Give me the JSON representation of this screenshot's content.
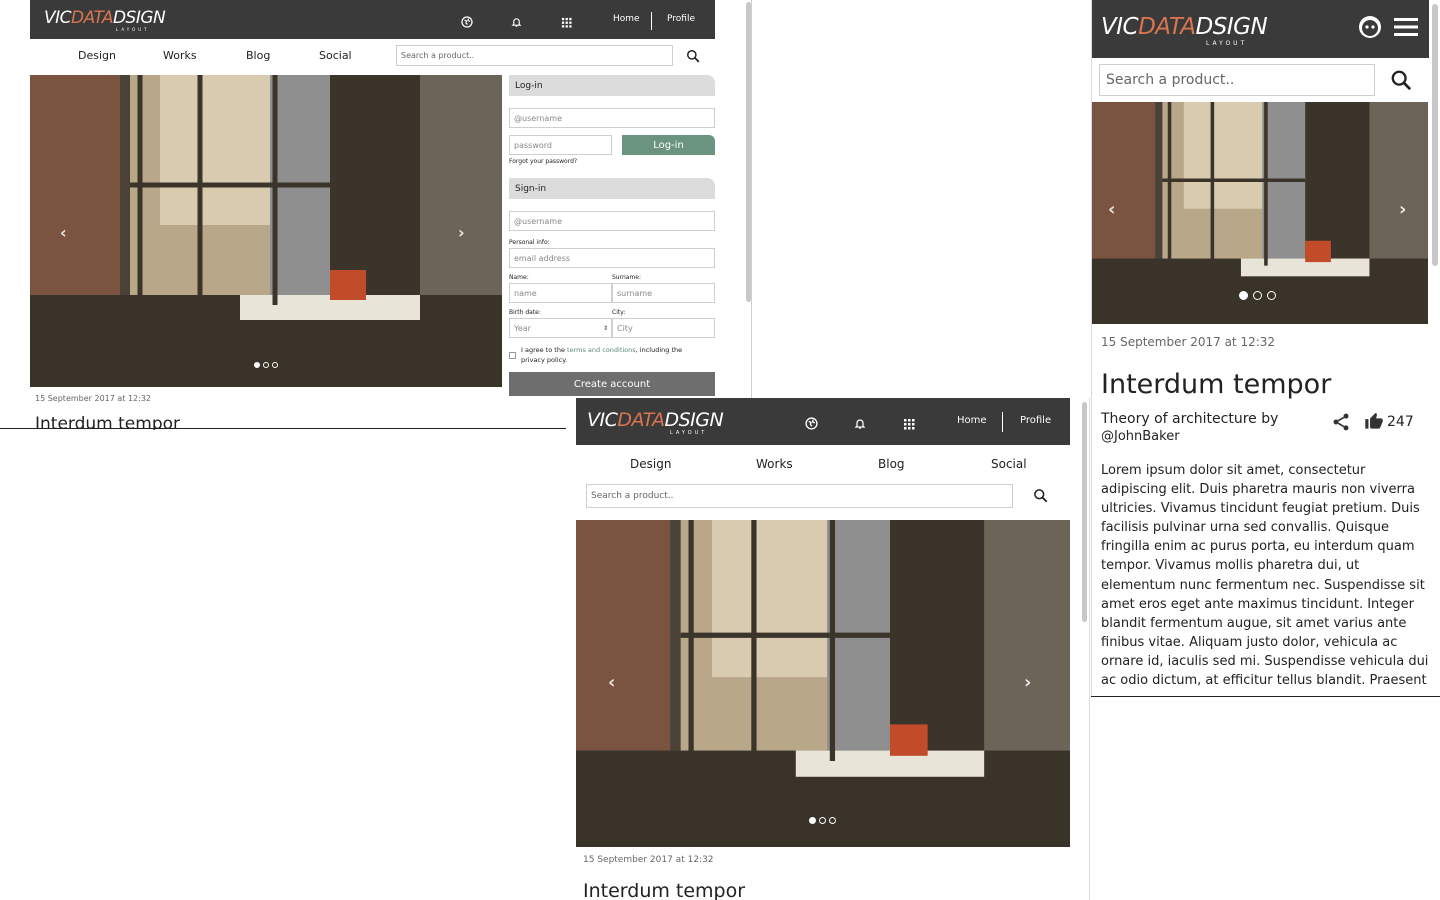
{
  "brand": {
    "logo_part1": "VIC",
    "logo_part2": "DATA",
    "logo_part3": "DSIGN",
    "logo_sub": "LAYOUT",
    "accent_color": "#d9754f",
    "header_color": "#3a3a3a"
  },
  "header": {
    "icons": [
      "globe-icon",
      "bell-icon",
      "grid-icon"
    ],
    "home_label": "Home",
    "profile_label": "Profile"
  },
  "nav": {
    "items": [
      "Design",
      "Works",
      "Blog",
      "Social"
    ]
  },
  "search": {
    "placeholder": "Search a product.."
  },
  "article": {
    "date": "15 September 2017 at 12:32",
    "title": "Interdum tempor",
    "subtitle_line1": "Theory of architecture by",
    "subtitle_line2": "@JohnBaker",
    "likes": "247",
    "body_lines": [
      "Lorem ipsum dolor sit amet, consectetur",
      "adipiscing elit. Duis pharetra mauris non viverra",
      "ultricies. Vivamus tincidunt feugiat pretium. Duis",
      "facilisis pulvinar urna sed convallis. Quisque",
      "fringilla enim ac purus porta, eu interdum quam",
      "tempor. Vivamus mollis pharetra dui, ut",
      "elementum nunc fermentum nec. Suspendisse sit",
      "amet eros eget ante maximus tincidunt. Integer",
      "blandit fermentum augue, sit amet varius ante",
      "finibus vitae. Aliquam justo dolor, vehicula ac",
      "ornare id, iaculis sed mi. Suspendisse vehicula dui",
      "ac odio dictum, at efficitur tellus blandit. Praesent"
    ]
  },
  "carousel": {
    "slides": 3,
    "active": 1
  },
  "login": {
    "heading": "Log-in",
    "username_placeholder": "@username",
    "password_placeholder": "password",
    "button": "Log-in",
    "button_color": "#6b9480",
    "forgot": "Forgot your password?"
  },
  "signin": {
    "heading": "Sign-in",
    "username_placeholder": "@username",
    "personal_label": "Personal info:",
    "email_placeholder": "email address",
    "name_label": "Name:",
    "surname_label": "Surname:",
    "name_placeholder": "name",
    "surname_placeholder": "surname",
    "birth_label": "Birth date:",
    "city_label": "City:",
    "year_value": "Year",
    "city_placeholder": "City",
    "terms_pre": "I agree to the",
    "terms_link": "terms and conditions",
    "terms_post": ", including the",
    "terms_line2": "privacy policy.",
    "create_button": "Create account",
    "create_color": "#6e6e6e"
  }
}
